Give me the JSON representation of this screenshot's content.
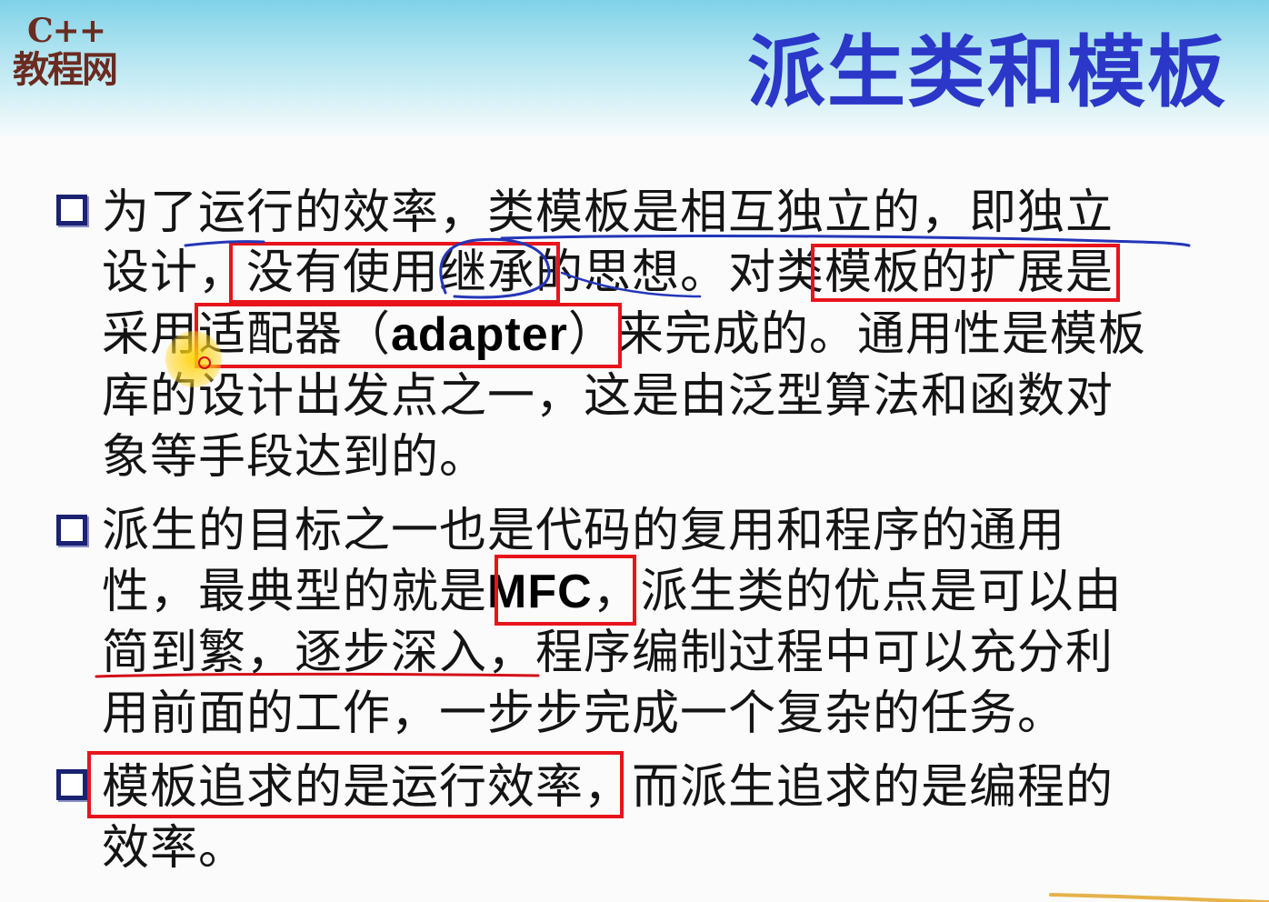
{
  "logo": {
    "line1": "C++",
    "line2": "教程网"
  },
  "title": "派生类和模板",
  "paragraphs": [
    {
      "lines": [
        {
          "pre": "为了运行的效率，类模板是相互独立的，即独立"
        },
        {
          "pre": "设计，没有使用继承的思想。对类模板的扩展是"
        },
        {
          "pre": "采用适配器（",
          "latin": "adapter",
          "post": "）来完成的。通用性是模板"
        },
        {
          "pre": "库的设计出发点之一，这是由泛型算法和函数对"
        },
        {
          "pre": "象等手段达到的。"
        }
      ]
    },
    {
      "lines": [
        {
          "pre": "派生的目标之一也是代码的复用和程序的通用"
        },
        {
          "pre": "性，最典型的就是",
          "latin": "MFC",
          "post": "，派生类的优点是可以由"
        },
        {
          "pre": "简到繁，逐步深入，程序编制过程中可以充分利"
        },
        {
          "pre": "用前面的工作，一步步完成一个复杂的任务。"
        }
      ]
    },
    {
      "lines": [
        {
          "pre": "模板追求的是运行效率，而派生追求的是编程的"
        },
        {
          "pre": "效率。"
        }
      ]
    }
  ],
  "colors": {
    "title": "#2a37c8",
    "logo": "#6b2b20",
    "highlight_box": "#e8141c",
    "pen_blue": "#2436b8",
    "pen_red": "#d4101a",
    "bullet": "#1b2272"
  }
}
